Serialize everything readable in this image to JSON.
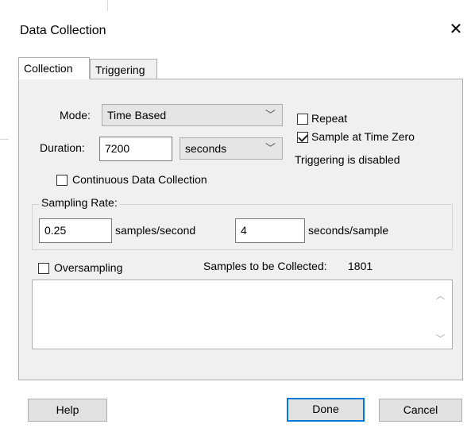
{
  "window": {
    "title": "Data Collection",
    "close_glyph": "✕"
  },
  "tabs": [
    {
      "label": "Collection",
      "active": true
    },
    {
      "label": "Triggering",
      "active": false
    }
  ],
  "mode": {
    "label": "Mode:",
    "value": "Time Based"
  },
  "duration": {
    "label": "Duration:",
    "value": "7200",
    "unit": "seconds"
  },
  "options": {
    "repeat": {
      "label": "Repeat",
      "checked": false
    },
    "sample_at_zero": {
      "label": "Sample at Time Zero",
      "checked": true
    },
    "triggering_status": "Triggering is disabled",
    "continuous": {
      "label": "Continuous Data Collection",
      "checked": false
    }
  },
  "sampling_rate": {
    "legend": "Sampling Rate:",
    "rate_value": "0.25",
    "rate_unit": "samples/second",
    "interval_value": "4",
    "interval_unit": "seconds/sample"
  },
  "oversampling": {
    "label": "Oversampling",
    "checked": false
  },
  "samples_collected": {
    "label": "Samples to be Collected:",
    "value": "1801"
  },
  "buttons": {
    "help": "Help",
    "done": "Done",
    "cancel": "Cancel"
  },
  "icons": {
    "close": "close-icon",
    "dropdown": "chevron-down-icon",
    "scroll_up": "scroll-up-icon",
    "scroll_down": "scroll-down-icon"
  }
}
